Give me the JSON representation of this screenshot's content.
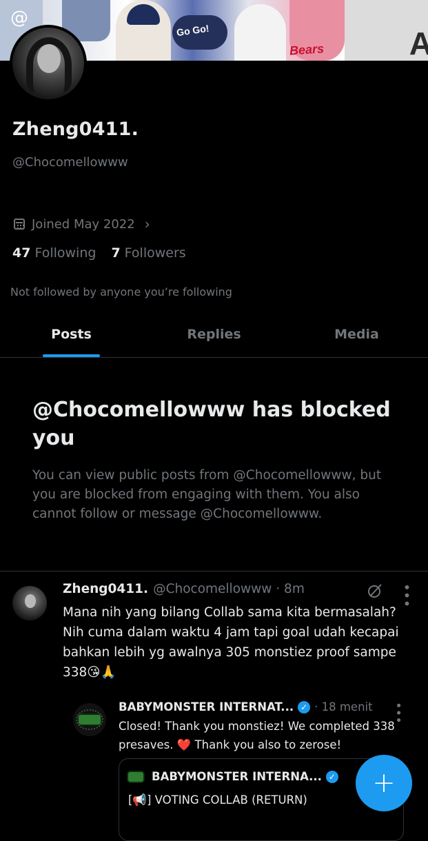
{
  "banner": {
    "gogo_text": "Go Go!",
    "bears_text": "Bears"
  },
  "profile": {
    "display_name": "Zheng0411.",
    "handle": "@Chocomellowww",
    "joined": "Joined May 2022",
    "following_count": "47",
    "following_label": "Following",
    "followers_count": "7",
    "followers_label": "Followers",
    "not_followed_text": "Not followed by anyone you’re following"
  },
  "tabs": [
    {
      "label": "Posts",
      "active": true
    },
    {
      "label": "Replies",
      "active": false
    },
    {
      "label": "Media",
      "active": false
    }
  ],
  "blocked": {
    "title": "@Chocomellowww has blocked you",
    "body": "You can view public posts from @Chocomellowww, but you are blocked from engaging with them. You also cannot follow or message @Chocomellowww."
  },
  "tweet": {
    "name": "Zheng0411.",
    "handle_time": "@Chocomellowww · 8m",
    "text": "Mana nih yang bilang Collab sama kita bermasalah? Nih cuma dalam waktu 4 jam tapi goal udah kecapai bahkan lebih yg awalnya 305 monstiez proof sampe 338😘🙏"
  },
  "quoted": {
    "name": "BABYMONSTER INTERNAT...",
    "time": "· 18 menit",
    "text": "Closed! Thank you monstiez! We completed 338 presaves. ❤️  Thank you also to zerose!",
    "inner_name": "BABYMONSTER INTERNA...",
    "inner_text": "[📢] VOTING COLLAB (RETURN)"
  },
  "colors": {
    "accent": "#1d9bf0",
    "background": "#000000",
    "text_primary": "#e7e9ea",
    "text_secondary": "#71767b",
    "border": "#2f3336"
  },
  "icons": {
    "calendar": "calendar-icon",
    "chevron": "chevron-right-icon",
    "grok": "grok-icon",
    "more": "more-vertical-icon",
    "verified": "verified-badge-icon",
    "compose": "plus-icon"
  }
}
